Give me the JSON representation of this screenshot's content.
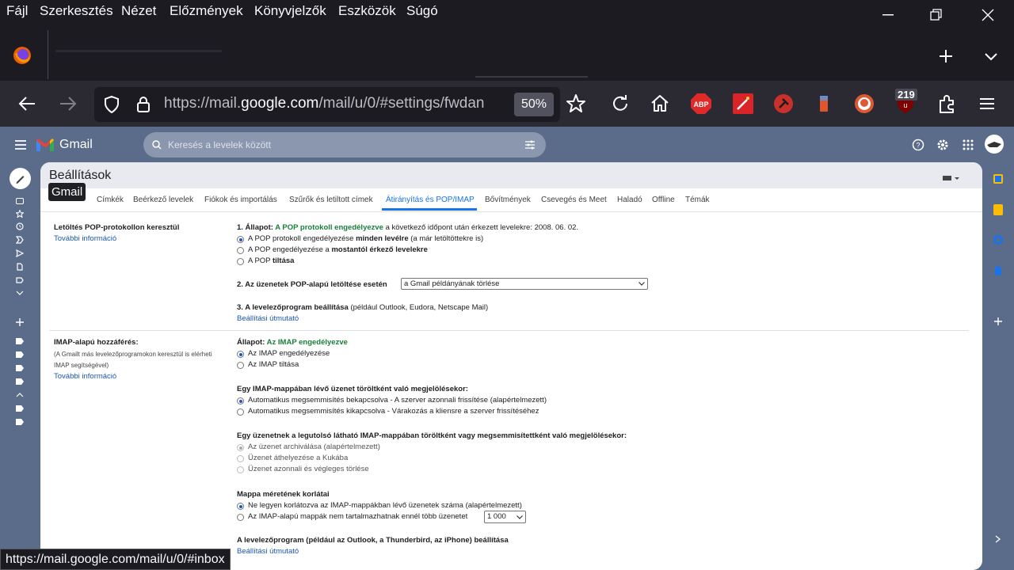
{
  "menubar": {
    "items": [
      "Fájl",
      "Szerkesztés",
      "Nézet",
      "Előzmények",
      "Könyvjelzők",
      "Eszközök",
      "Súgó"
    ]
  },
  "navbar": {
    "url_prefix": "https://mail.",
    "url_domain": "google.com",
    "url_rest": "/mail/u/0/#settings/fwdan",
    "zoom": "50%",
    "ublock_count": "219"
  },
  "gmail": {
    "logo_text": "Gmail",
    "search_placeholder": "Keresés a levelek között",
    "tooltip": "Gmail",
    "settings_title": "Beállítások",
    "tabs": [
      "Címkék",
      "Beérkező levelek",
      "Fiókok és importálás",
      "Szűrők és letiltott címek",
      "Átirányítás és POP/IMAP",
      "Bővítmények",
      "Csevegés és Meet",
      "Haladó",
      "Offline",
      "Témák"
    ],
    "active_tab": "Átirányítás és POP/IMAP"
  },
  "pop": {
    "section_label": "Letöltés POP-protokollon keresztül",
    "more_info": "További információ",
    "status_prefix": "1. Állapot: ",
    "status_value": "A POP protokoll engedélyezve",
    "status_suffix": " a következő időpont után érkezett levelekre: 2008. 06. 02.",
    "opt1_pre": "A POP protokoll engedélyezése ",
    "opt1_bold": "minden levélre",
    "opt1_post": " (a már letöltöttekre is)",
    "opt2_pre": "A POP engedélyezése a ",
    "opt2_bold": "mostantól érkező levelekre",
    "opt3_pre": "A POP ",
    "opt3_bold": "tiltása",
    "step2_label": "2. Az üzenetek POP-alapú letöltése esetén",
    "step2_select": "a Gmail példányának törlése",
    "step3_bold": "3. A levelezőprogram beállítása",
    "step3_rest": " (például Outlook, Eudora, Netscape Mail)",
    "setup_guide": "Beállítási útmutató"
  },
  "imap": {
    "section_label": "IMAP-alapú hozzáférés:",
    "section_sub1": "(A Gmailt más levelezőprogramokon keresztül is elérheti",
    "section_sub2": "IMAP segítségével)",
    "more_info": "További információ",
    "status_prefix": "Állapot: ",
    "status_value": "Az IMAP engedélyezve",
    "enable": "Az IMAP engedélyezése",
    "disable": "Az IMAP tiltása",
    "deleted_heading": "Egy IMAP-mappában lévő üzenet töröltként való megjelölésekor:",
    "auto_on": "Automatikus megsemmisítés bekapcsolva - A szerver azonnali frissítése (alapértelmezett)",
    "auto_off": "Automatikus megsemmisítés kikapcsolva - Várakozás a kliensre a szerver frissítéséhez",
    "expunge_heading": "Egy üzenetnek a legutolsó látható IMAP-mappában töröltként vagy megsemmisítettként való megjelölésekor:",
    "archive": "Az üzenet archiválása (alapértelmezett)",
    "trash": "Üzenet áthelyezése a Kukába",
    "delete_forever": "Üzenet azonnali és végleges törlése",
    "folder_heading": "Mappa méretének korlátai",
    "no_limit": "Ne legyen korlátozva az IMAP-mappákban lévő üzenetek száma (alapértelmezett)",
    "limit": "Az IMAP-alapú mappák nem tartalmazhatnak ennél több üzenetet",
    "limit_value": "1 000",
    "client_heading": "A levelezőprogram (például az Outlook, a Thunderbird, az iPhone) beállítása",
    "setup_guide": "Beállítási útmutató"
  },
  "status_bar": "https://mail.google.com/mail/u/0/#inbox",
  "colors": {
    "accent": "#1a73e8",
    "green": "#188038",
    "gmail_bg": "#5b6b8a"
  }
}
